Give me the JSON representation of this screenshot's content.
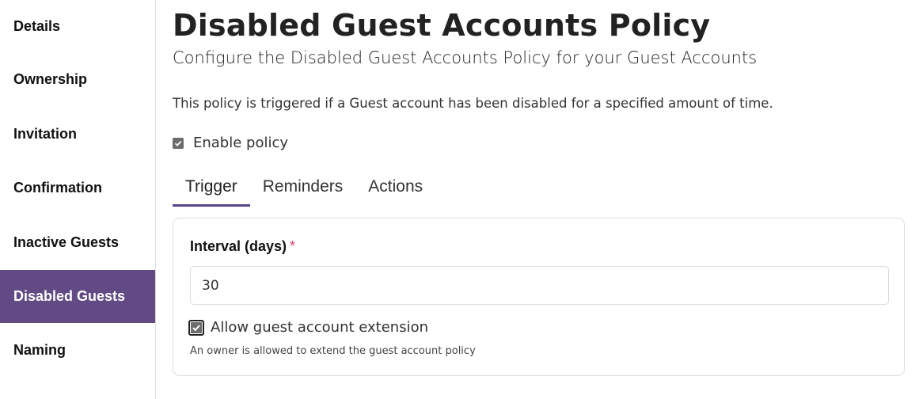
{
  "sidebar": {
    "items": [
      {
        "label": "Details",
        "active": false
      },
      {
        "label": "Ownership",
        "active": false
      },
      {
        "label": "Invitation",
        "active": false
      },
      {
        "label": "Confirmation",
        "active": false
      },
      {
        "label": "Inactive Guests",
        "active": false
      },
      {
        "label": "Disabled Guests",
        "active": true
      },
      {
        "label": "Naming",
        "active": false
      }
    ],
    "active_color": "#624a84"
  },
  "page": {
    "title": "Disabled Guest Accounts Policy",
    "subtitle": "Configure the Disabled Guest Accounts Policy for your Guest Accounts",
    "description": "This policy is triggered if a Guest account has been disabled for a specified amount of time.",
    "enable_policy": {
      "label": "Enable policy",
      "checked": true
    }
  },
  "tabs": [
    {
      "label": "Trigger",
      "active": true
    },
    {
      "label": "Reminders",
      "active": false
    },
    {
      "label": "Actions",
      "active": false
    }
  ],
  "trigger": {
    "interval_label": "Interval (days)",
    "required_marker": "*",
    "interval_value": "30",
    "extension": {
      "label": "Allow guest account extension",
      "checked": true
    },
    "extension_help": "An owner is allowed to extend the guest account policy"
  }
}
